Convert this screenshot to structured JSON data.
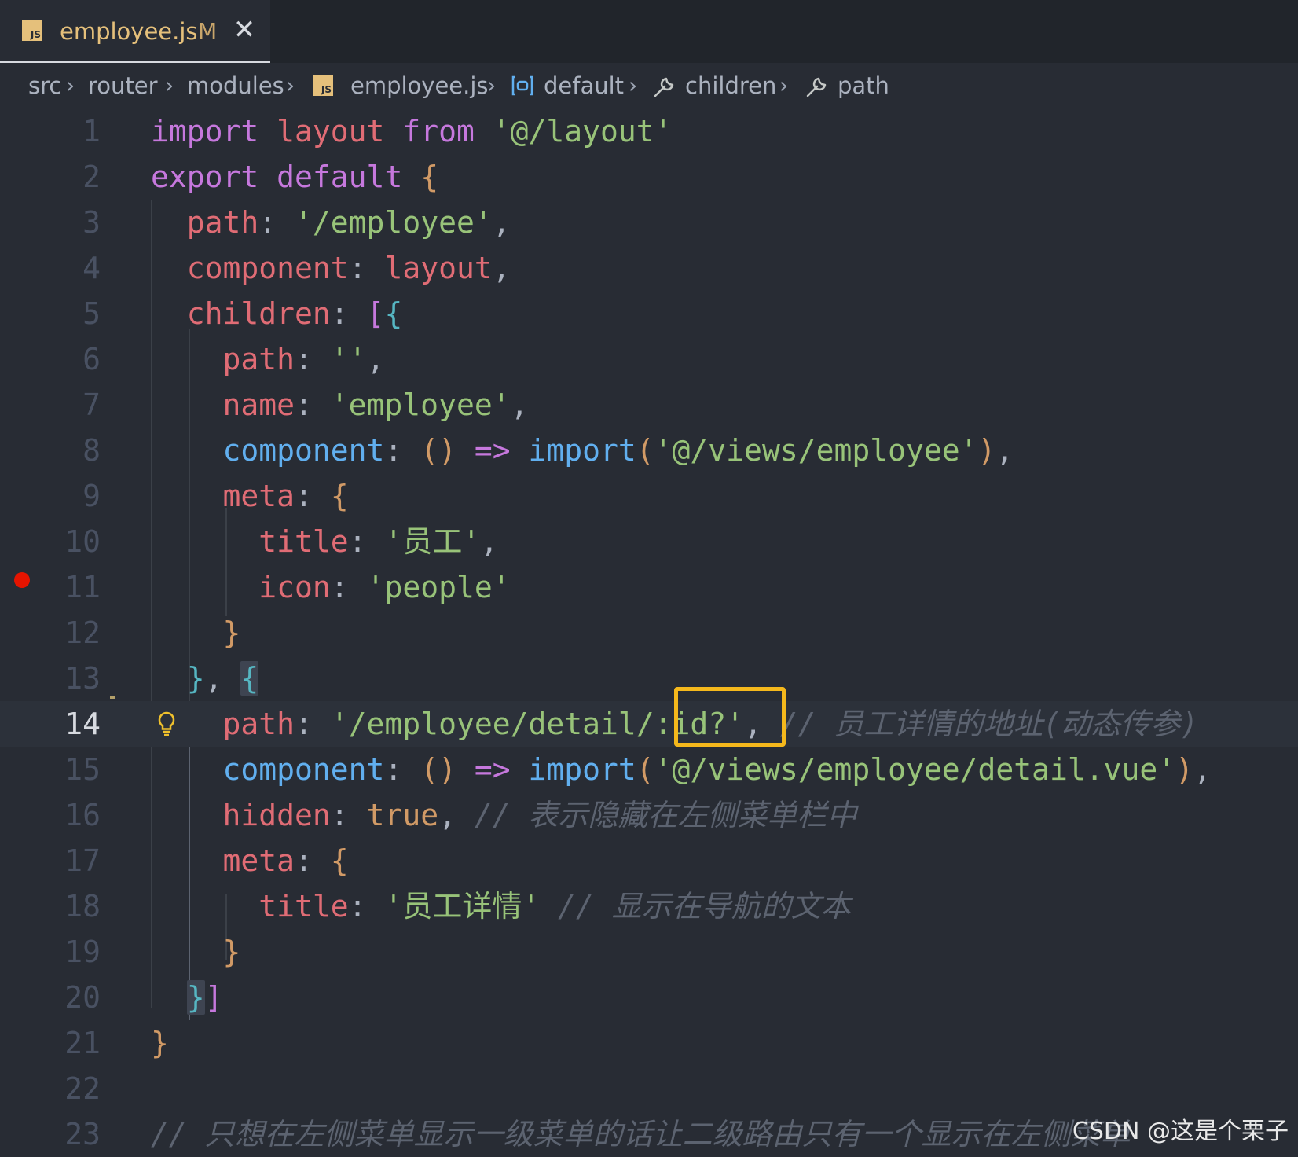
{
  "tab": {
    "filename": "employee.js",
    "status": "M",
    "icon": "js-file-icon",
    "badge": "JS"
  },
  "breadcrumb": {
    "items": [
      "src",
      "router",
      "modules",
      "employee.js",
      "default",
      "children",
      "path"
    ],
    "separator": "›"
  },
  "editor": {
    "current_line": 14,
    "breakpoint_line": 11,
    "lines": [
      {
        "n": "1"
      },
      {
        "n": "2"
      },
      {
        "n": "3"
      },
      {
        "n": "4"
      },
      {
        "n": "5"
      },
      {
        "n": "6"
      },
      {
        "n": "7"
      },
      {
        "n": "8"
      },
      {
        "n": "9"
      },
      {
        "n": "10"
      },
      {
        "n": "11"
      },
      {
        "n": "12"
      },
      {
        "n": "13"
      },
      {
        "n": "14"
      },
      {
        "n": "15"
      },
      {
        "n": "16"
      },
      {
        "n": "17"
      },
      {
        "n": "18"
      },
      {
        "n": "19"
      },
      {
        "n": "20"
      },
      {
        "n": "21"
      },
      {
        "n": "22"
      },
      {
        "n": "23"
      }
    ],
    "tokens": {
      "l1": [
        "import",
        " layout ",
        "from",
        " ",
        "'@/layout'"
      ],
      "l2": [
        "export",
        " ",
        "default",
        " ",
        "{"
      ],
      "l3": [
        "path",
        ": ",
        "'/employee'",
        ","
      ],
      "l4": [
        "component",
        ": ",
        "layout",
        ","
      ],
      "l5": [
        "children",
        ": ",
        "[",
        "{"
      ],
      "l6": [
        "path",
        ": ",
        "''",
        ","
      ],
      "l7": [
        "name",
        ": ",
        "'employee'",
        ","
      ],
      "l8": [
        "component",
        ": ",
        "()",
        " ",
        "=>",
        " ",
        "import",
        "(",
        "'@/views/employee'",
        ")",
        ","
      ],
      "l9": [
        "meta",
        ": ",
        "{"
      ],
      "l10": [
        "title",
        ": ",
        "'员工'",
        ","
      ],
      "l11": [
        "icon",
        ": ",
        "'people'"
      ],
      "l12": [
        "}"
      ],
      "l13": [
        "}",
        ", ",
        "{"
      ],
      "l14": [
        "path",
        ": ",
        "'/employee/detail/",
        ":id?'",
        ",",
        " // 员工详情的地址(动态传参)"
      ],
      "l15": [
        "component",
        ": ",
        "()",
        " ",
        "=>",
        " ",
        "import",
        "(",
        "'@/views/employee/detail.vue'",
        ")",
        ","
      ],
      "l16": [
        "hidden",
        ": ",
        "true",
        ",",
        " // 表示隐藏在左侧菜单栏中"
      ],
      "l17": [
        "meta",
        ": ",
        "{"
      ],
      "l18": [
        "title",
        ": ",
        "'员工详情'",
        " // 显示在导航的文本"
      ],
      "l19": [
        "}"
      ],
      "l20": [
        "}",
        "]"
      ],
      "l21": [
        "}"
      ],
      "l22": [
        ""
      ],
      "l23": [
        "// 只想在左侧菜单显示一级菜单的话让二级路由只有一个显示在左侧菜单"
      ]
    }
  },
  "watermark": "CSDN @这是个栗子",
  "colors": {
    "background": "#282c34",
    "keyword": "#c678dd",
    "property": "#e06c75",
    "string": "#98c379",
    "function": "#61afef",
    "comment": "#5c6370",
    "highlight_box": "#f5b81c",
    "breakpoint": "#e51400"
  }
}
